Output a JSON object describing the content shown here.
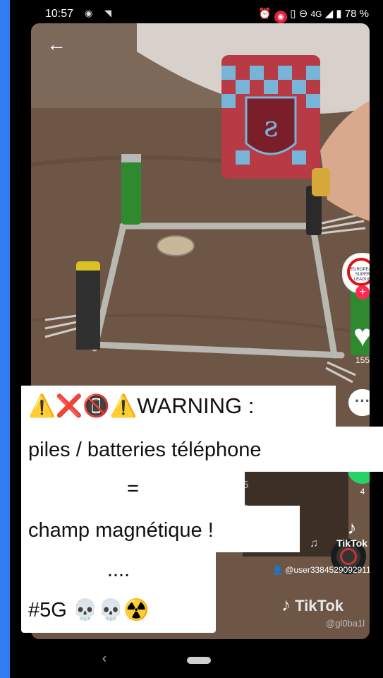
{
  "status_bar": {
    "time": "10:57",
    "network": "4G",
    "battery": "78 %"
  },
  "post": {
    "likes": "155",
    "shares": "4",
    "music_user": "@user3384529092911",
    "tiktok_label_small": "TikTok",
    "tiktok_label_large": "TikTok",
    "watermark_handle": "@gl0ba1l",
    "badge_text": "EUROPEAN SUPER LEAGUE",
    "hidden_text_1": "5",
    "hidden_text_2": "ь"
  },
  "caption": {
    "line1_emojis": "⚠️❌📵⚠️",
    "line1_text": "WARNING :",
    "line2": "piles / batteries téléphone",
    "line3": "=",
    "line4": "champ magnétique !",
    "line5": "....",
    "line6_text": "#5G",
    "line6_emojis": "💀💀☢️"
  },
  "colors": {
    "accent_red": "#fe2c55",
    "whatsapp_green": "#25d366",
    "background_blue": "#2f7df0"
  }
}
